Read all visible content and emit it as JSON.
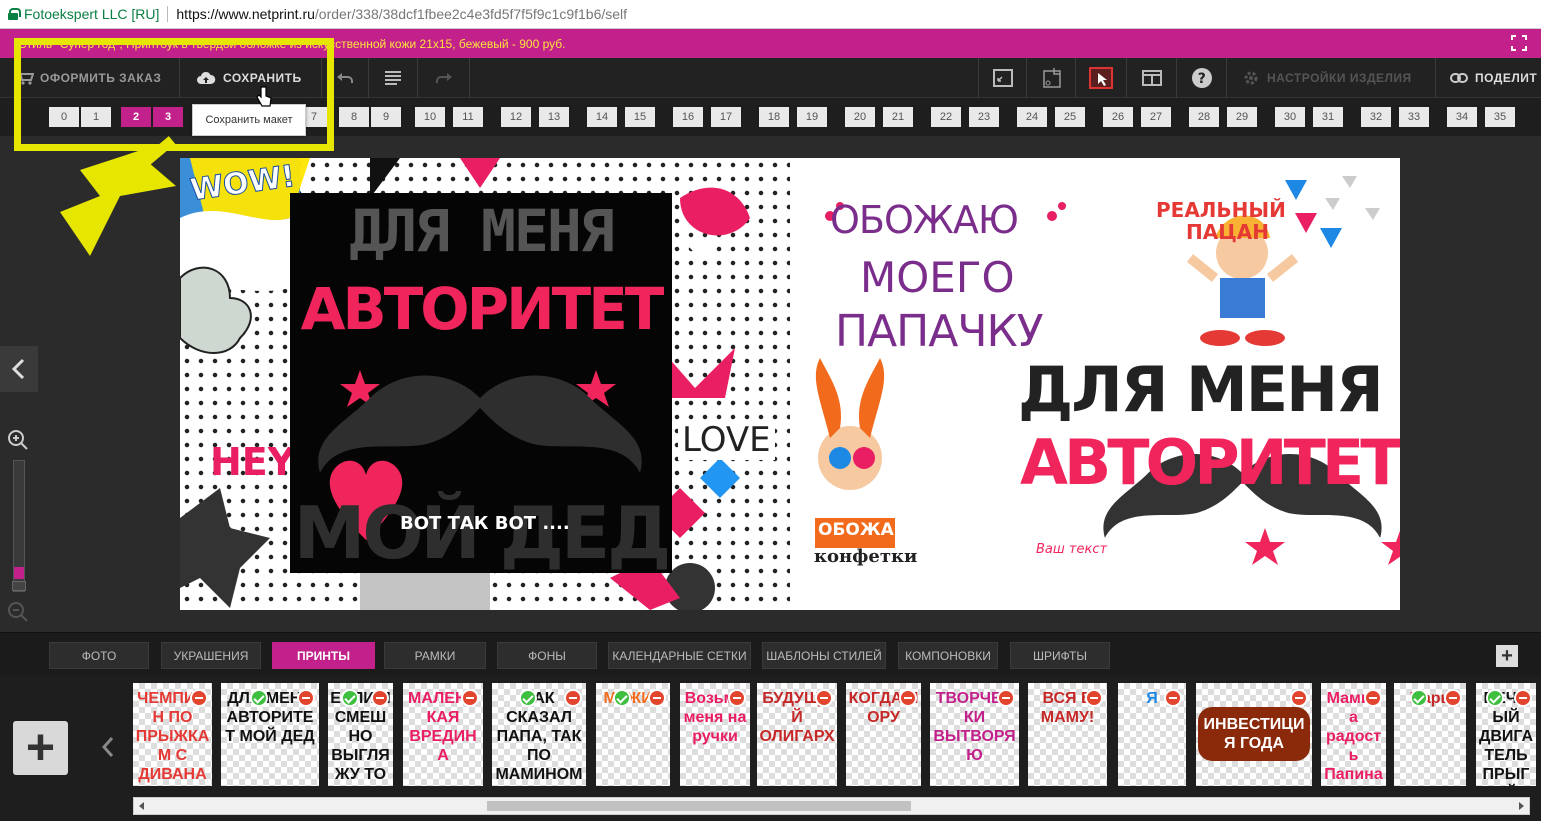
{
  "browser": {
    "site": "Fotoekspert LLC [RU]",
    "url_host": "https://www.netprint.ru",
    "url_path": "/order/338/38dcf1fbee2c4e3fd5f7f5f9c1c9f1b6/self"
  },
  "product_title": "Стиль \"Супер год\", Принтбук в твердой обложке из искусственной кожи 21х15, бежевый - 900 руб.",
  "toolbar": {
    "order_label": "ОФОРМИТЬ ЗАКАЗ",
    "save_label": "СОХРАНИТЬ",
    "settings_label": "НАСТРОЙКИ ИЗДЕЛИЯ",
    "share_label": "ПОДЕЛИТ",
    "save_tooltip": "Сохранить макет"
  },
  "pages": [
    "0",
    "1",
    "2",
    "3",
    "7",
    "8",
    "9",
    "10",
    "11",
    "12",
    "13",
    "14",
    "15",
    "16",
    "17",
    "18",
    "19",
    "20",
    "21",
    "22",
    "23",
    "24",
    "25",
    "26",
    "27",
    "28",
    "29",
    "30",
    "31",
    "32",
    "33",
    "34",
    "35"
  ],
  "selected_pages": [
    "2",
    "3"
  ],
  "canvas": {
    "left": {
      "wow": "WOW!",
      "hey": "HEY!",
      "love": "LOVE",
      "line1": "ДЛЯ МЕНЯ",
      "line2": "АВТОРИТЕТ",
      "line3": "МОЙ ДЕД",
      "caption": "ВОТ ТАК ВОТ ...."
    },
    "right": {
      "obozhau1": "ОБОЖАЮ",
      "obozhau2": "МОЕГО",
      "obozhau3": "ПАПАЧКУ",
      "real1": "РЕАЛЬНЫЙ",
      "real2": "ПАЦАН",
      "line1": "ДЛЯ МЕНЯ",
      "line2": "АВТОРИТЕТ",
      "vash": "Ваш текст",
      "candy1": "ОБОЖАЮ",
      "candy2": "конфетки"
    }
  },
  "tabs": [
    "ФОТО",
    "УКРАШЕНИЯ",
    "ПРИНТЫ",
    "РАМКИ",
    "ФОНЫ",
    "КАЛЕНДАРНЫЕ СЕТКИ",
    "ШАБЛОНЫ СТИЛЕЙ",
    "КОМПОНОВКИ",
    "ШРИФТЫ"
  ],
  "active_tab": "ПРИНТЫ",
  "thumbnails": [
    {
      "text": "ЧЕМПИОН ПО ПРЫЖКАМ С ДИВАНА",
      "used": false
    },
    {
      "text": "ДЛЯ МЕНЯ АВТОРИТЕТ МОЙ ДЕД",
      "used": true
    },
    {
      "text": "ЕСЛИ Я СМЕШНО ВЫГЛЯЖУ ТО ВИДЕЛИ Б МЕНЯ ПАПА!",
      "used": true
    },
    {
      "text": "МАЛЕНЬКАЯ ВРЕДИНА",
      "used": false
    },
    {
      "text": "КАК СКАЗАЛ ПАПА, ТАК ПО МАМИНОМУ И БУДЕТ!",
      "used": true
    },
    {
      "text": "МУЖИК",
      "used": true
    },
    {
      "text": "Возьми меня на ручки",
      "used": false
    },
    {
      "text": "БУДУЩИЙ ОЛИГАРХ",
      "used": false
    },
    {
      "text": "КОГДА Я ОРУ",
      "used": false
    },
    {
      "text": "ТВОРЧЕСКИ ВЫТВОРЯЮ",
      "used": false
    },
    {
      "text": "ВСЯ В МАМУ!",
      "used": false
    },
    {
      "text": "Я",
      "used": false
    },
    {
      "text": "ИНВЕСТИЦИЯ ГОДА",
      "used": false
    },
    {
      "text": "Мамина радость Папина гордость",
      "used": false
    },
    {
      "text": "Царь",
      "used": true
    },
    {
      "text": "ВЕЧНЫЙ ДВИГАТЕЛЬ ПРЫГАЙ",
      "used": true
    }
  ],
  "colors": {
    "accent": "#c2208a",
    "highlight": "#e6e600",
    "title_text": "#ffe33f"
  },
  "icons": [
    "cart-icon",
    "cloud-upload-icon",
    "undo-icon",
    "list-icon",
    "redo-icon",
    "fit-icon",
    "crop-icon",
    "preview-icon",
    "layout-icon",
    "help-icon",
    "gear-icon",
    "link-icon",
    "chevron-left-icon",
    "zoom-in-icon",
    "zoom-out-icon",
    "plus-icon",
    "fullscreen-icon"
  ]
}
